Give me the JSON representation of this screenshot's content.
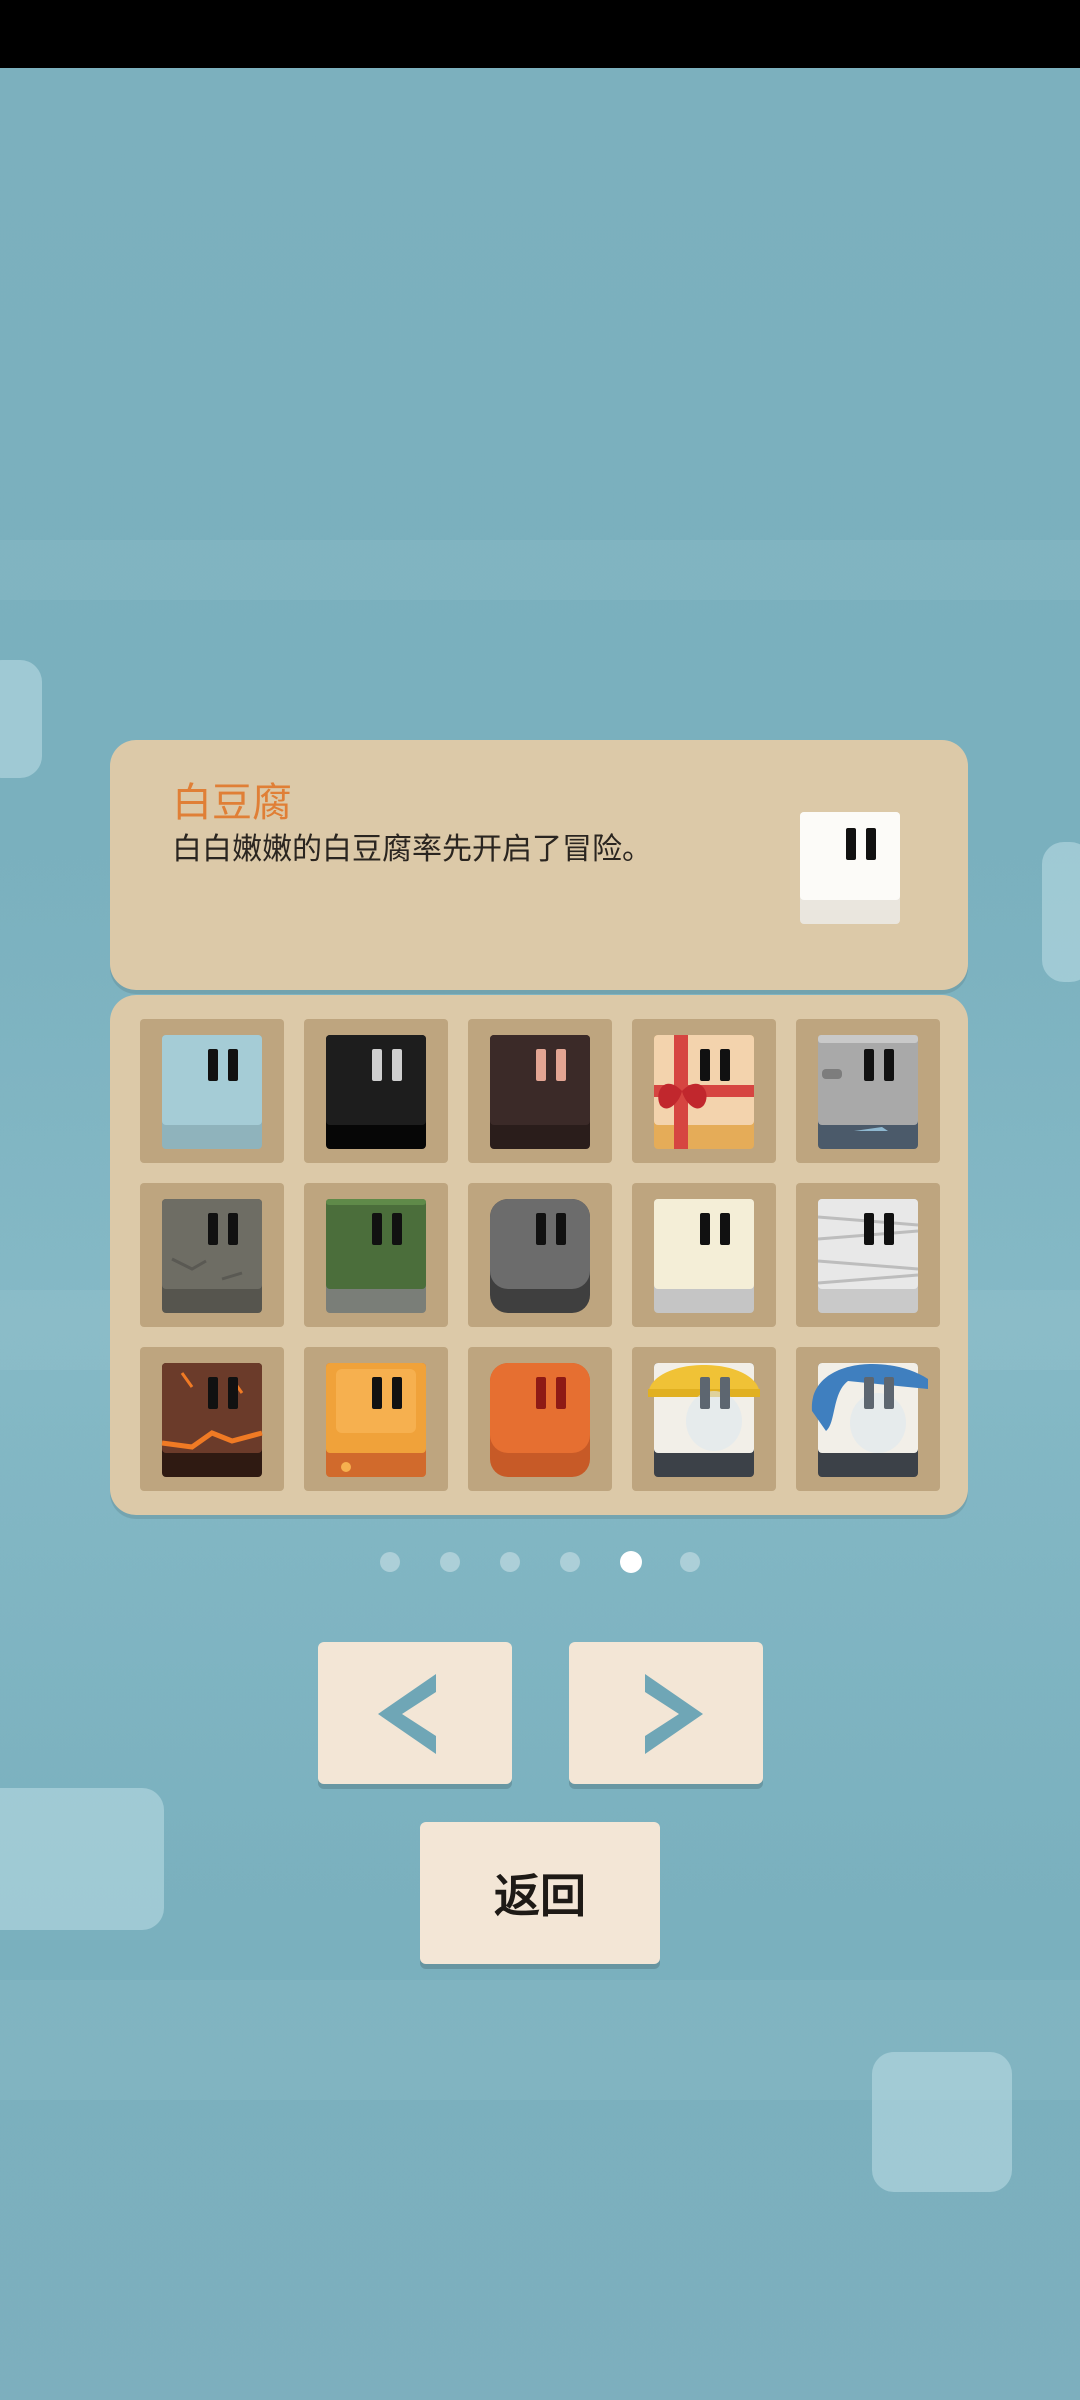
{
  "info": {
    "title": "白豆腐",
    "description": "白白嫩嫩的白豆腐率先开启了冒险。"
  },
  "characters": [
    {
      "name": "blue-ice-tofu",
      "body": "#a5ccd6",
      "base": "#8fb3bc",
      "eyes": "#111111"
    },
    {
      "name": "black-tofu",
      "body": "#1d1d1d",
      "base": "#060606",
      "eyes": "#cfcfcf"
    },
    {
      "name": "dark-brown-tofu",
      "body": "#3b2a28",
      "base": "#2a1d1b",
      "eyes": "#e3a593"
    },
    {
      "name": "gift-box-tofu",
      "body": "#f3d3ad",
      "base": "#e5ac58",
      "eyes": "#111111"
    },
    {
      "name": "tin-can-tofu",
      "body": "#a9a9a9",
      "base": "#4b5a6a",
      "eyes": "#111111"
    },
    {
      "name": "stone-tofu",
      "body": "#6e6d64",
      "base": "#56554e",
      "eyes": "#111111"
    },
    {
      "name": "moss-tofu",
      "body": "#4b6e3b",
      "base": "#7a7e78",
      "eyes": "#111111"
    },
    {
      "name": "gray-rock-tofu",
      "body": "#6c6c6c",
      "base": "#3f3f3f",
      "eyes": "#111111"
    },
    {
      "name": "cream-tofu",
      "body": "#f4eed7",
      "base": "#c5c5c5",
      "eyes": "#111111"
    },
    {
      "name": "mummy-tofu",
      "body": "#e8e8e8",
      "base": "#c9c9c9",
      "eyes": "#111111"
    },
    {
      "name": "lava-tofu",
      "body": "#6b3b2a",
      "base": "#2f1a12",
      "eyes": "#111111"
    },
    {
      "name": "honey-tofu",
      "body": "#f0a23a",
      "base": "#d16a2c",
      "eyes": "#111111"
    },
    {
      "name": "orange-tofu",
      "body": "#e66f31",
      "base": "#c75a27",
      "eyes": "#8e1a15"
    },
    {
      "name": "hardhat-tofu",
      "body": "#f2efe8",
      "base": "#3c4148",
      "eyes": "#5d6670"
    },
    {
      "name": "blue-hair-tofu",
      "body": "#f2efe8",
      "base": "#3c4148",
      "eyes": "#5d6670"
    }
  ],
  "pagination": {
    "total": 6,
    "current": 5
  },
  "buttons": {
    "back_label": "返回"
  }
}
